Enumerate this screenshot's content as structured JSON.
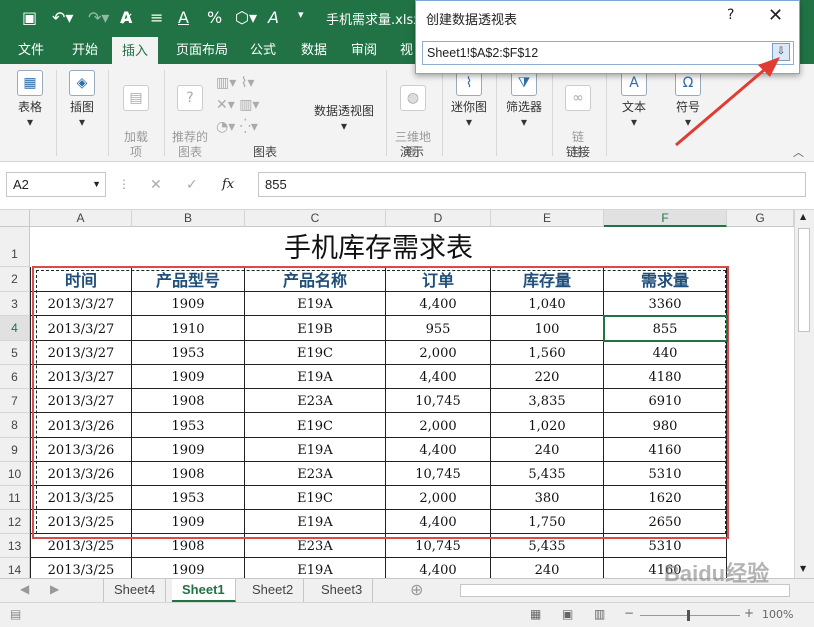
{
  "window": {
    "filename": "手机需求量.xlsx",
    "quick_access": [
      "save-icon",
      "undo-icon",
      "redo-icon",
      "font-icon",
      "align-icon",
      "font-color-icon",
      "percent-icon",
      "shape-icon",
      "font-style-icon"
    ]
  },
  "ribbon_tabs": [
    "文件",
    "开始",
    "插入",
    "页面布局",
    "公式",
    "数据",
    "审阅",
    "视"
  ],
  "active_tab": "插入",
  "ribbon": {
    "table": "表格",
    "illustrations": "插图",
    "addins": "加载\n项",
    "recommended_charts": "推荐的\n图表",
    "pivotchart": "数据透视图",
    "map3d": "三维地\n图",
    "sparkline": "迷你图",
    "filter": "筛选器",
    "link": "链\n接",
    "text": "文本",
    "symbol": "符号",
    "groups": {
      "charts": "图表",
      "tours": "演示",
      "links": "链接"
    }
  },
  "dialog": {
    "title": "创建数据透视表",
    "help": "?",
    "close": "✕",
    "range": "Sheet1!$A$2:$F$12"
  },
  "formula_bar": {
    "name_box": "A2",
    "cancel": "✕",
    "enter": "✓",
    "fx": "fx",
    "value": "855"
  },
  "grid": {
    "columns": [
      "A",
      "B",
      "C",
      "D",
      "E",
      "F",
      "G"
    ],
    "selected_column": "F",
    "rows": [
      "1",
      "2",
      "3",
      "4",
      "5",
      "6",
      "7",
      "8",
      "9",
      "10",
      "11",
      "12",
      "13",
      "14"
    ],
    "selected_row": "4",
    "title": "手机库存需求表",
    "headers": [
      "时间",
      "产品型号",
      "产品名称",
      "订单",
      "库存量",
      "需求量"
    ],
    "data": [
      [
        "2013/3/27",
        "1909",
        "E19A",
        "4,400",
        "1,040",
        "3360"
      ],
      [
        "2013/3/27",
        "1910",
        "E19B",
        "955",
        "100",
        "855"
      ],
      [
        "2013/3/27",
        "1953",
        "E19C",
        "2,000",
        "1,560",
        "440"
      ],
      [
        "2013/3/27",
        "1909",
        "E19A",
        "4,400",
        "220",
        "4180"
      ],
      [
        "2013/3/27",
        "1908",
        "E23A",
        "10,745",
        "3,835",
        "6910"
      ],
      [
        "2013/3/26",
        "1953",
        "E19C",
        "2,000",
        "1,020",
        "980"
      ],
      [
        "2013/3/26",
        "1909",
        "E19A",
        "4,400",
        "240",
        "4160"
      ],
      [
        "2013/3/26",
        "1908",
        "E23A",
        "10,745",
        "5,435",
        "5310"
      ],
      [
        "2013/3/25",
        "1953",
        "E19C",
        "2,000",
        "380",
        "1620"
      ],
      [
        "2013/3/25",
        "1909",
        "E19A",
        "4,400",
        "1,750",
        "2650"
      ],
      [
        "2013/3/25",
        "1908",
        "E23A",
        "10,745",
        "5,435",
        "5310"
      ],
      [
        "2013/3/25",
        "1909",
        "E19A",
        "4,400",
        "240",
        "4160"
      ]
    ]
  },
  "sheets": [
    "Sheet4",
    "Sheet1",
    "Sheet2",
    "Sheet3"
  ],
  "active_sheet": "Sheet1",
  "status": {
    "zoom": "100%"
  },
  "watermark": "Baidu经验"
}
